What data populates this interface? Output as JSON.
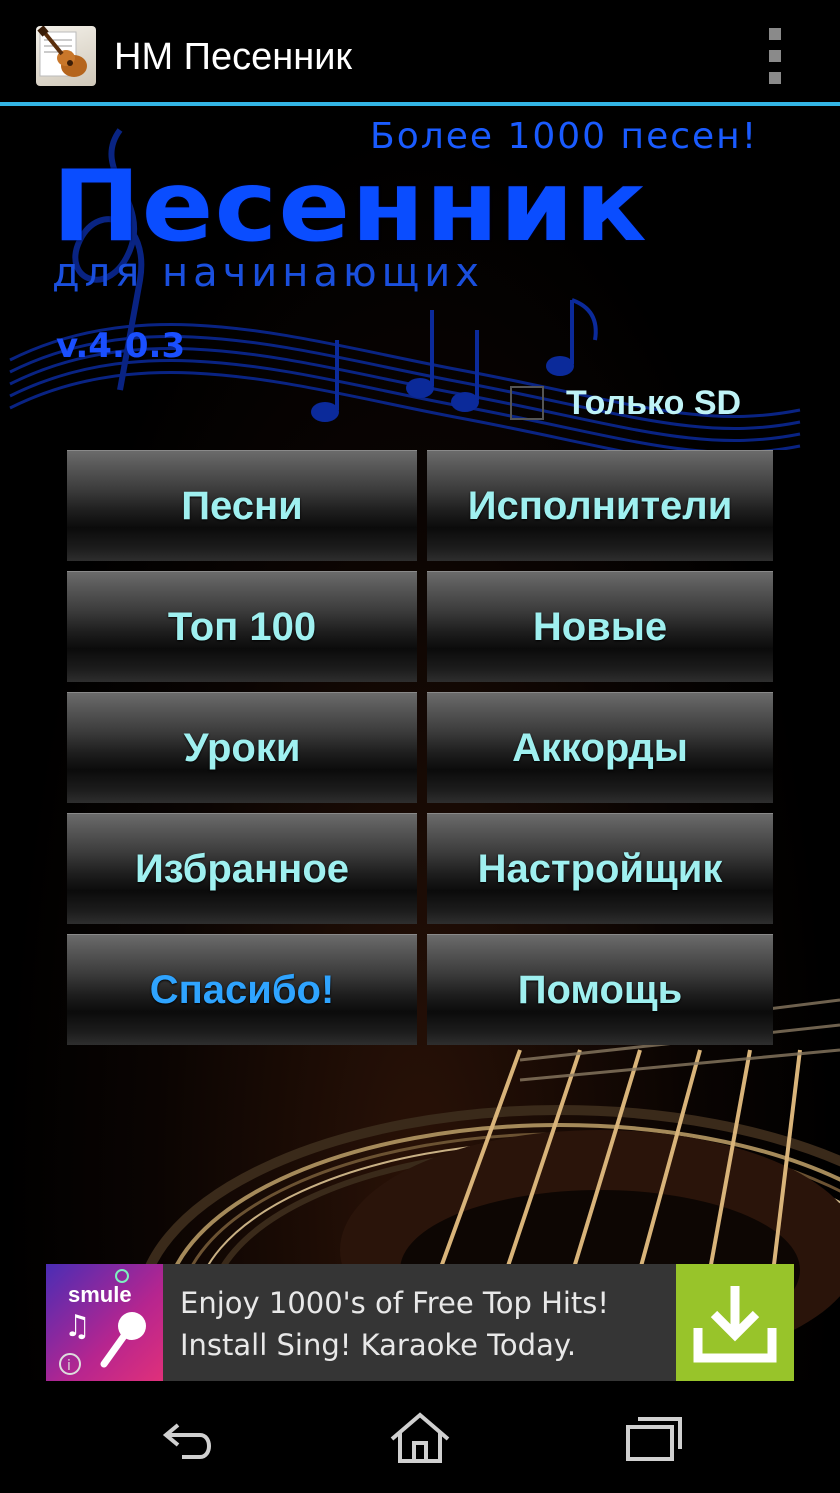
{
  "action_bar": {
    "title": "НМ Песенник",
    "app_icon": "guitar-icon",
    "overflow_icon": "overflow-menu-icon"
  },
  "logo": {
    "promo": "Более 1000 песен!",
    "title": "Песенник",
    "subtitle": "для начинающих",
    "version": "v.4.0.3"
  },
  "sd_option": {
    "label": "Только SD",
    "checked": false
  },
  "menu": {
    "songs": "Песни",
    "artists": "Исполнители",
    "top100": "Топ 100",
    "new": "Новые",
    "lessons": "Уроки",
    "chords": "Аккорды",
    "favorites": "Избранное",
    "tuner": "Настройщик",
    "thanks": "Спасибо!",
    "help": "Помощь"
  },
  "ad": {
    "brand": "smule",
    "line1": "Enjoy 1000's of Free Top Hits!",
    "line2": "Install Sing! Karaoke Today.",
    "icon": "download-icon"
  },
  "nav_bar": {
    "back_icon": "back-icon",
    "home_icon": "home-icon",
    "recents_icon": "recents-icon"
  },
  "colors": {
    "accent": "#33b5e5",
    "button_text": "#9ff0f0",
    "thanks_text": "#2fa4ff",
    "logo_blue": "#0a4dff",
    "ad_green": "#98c42a"
  }
}
